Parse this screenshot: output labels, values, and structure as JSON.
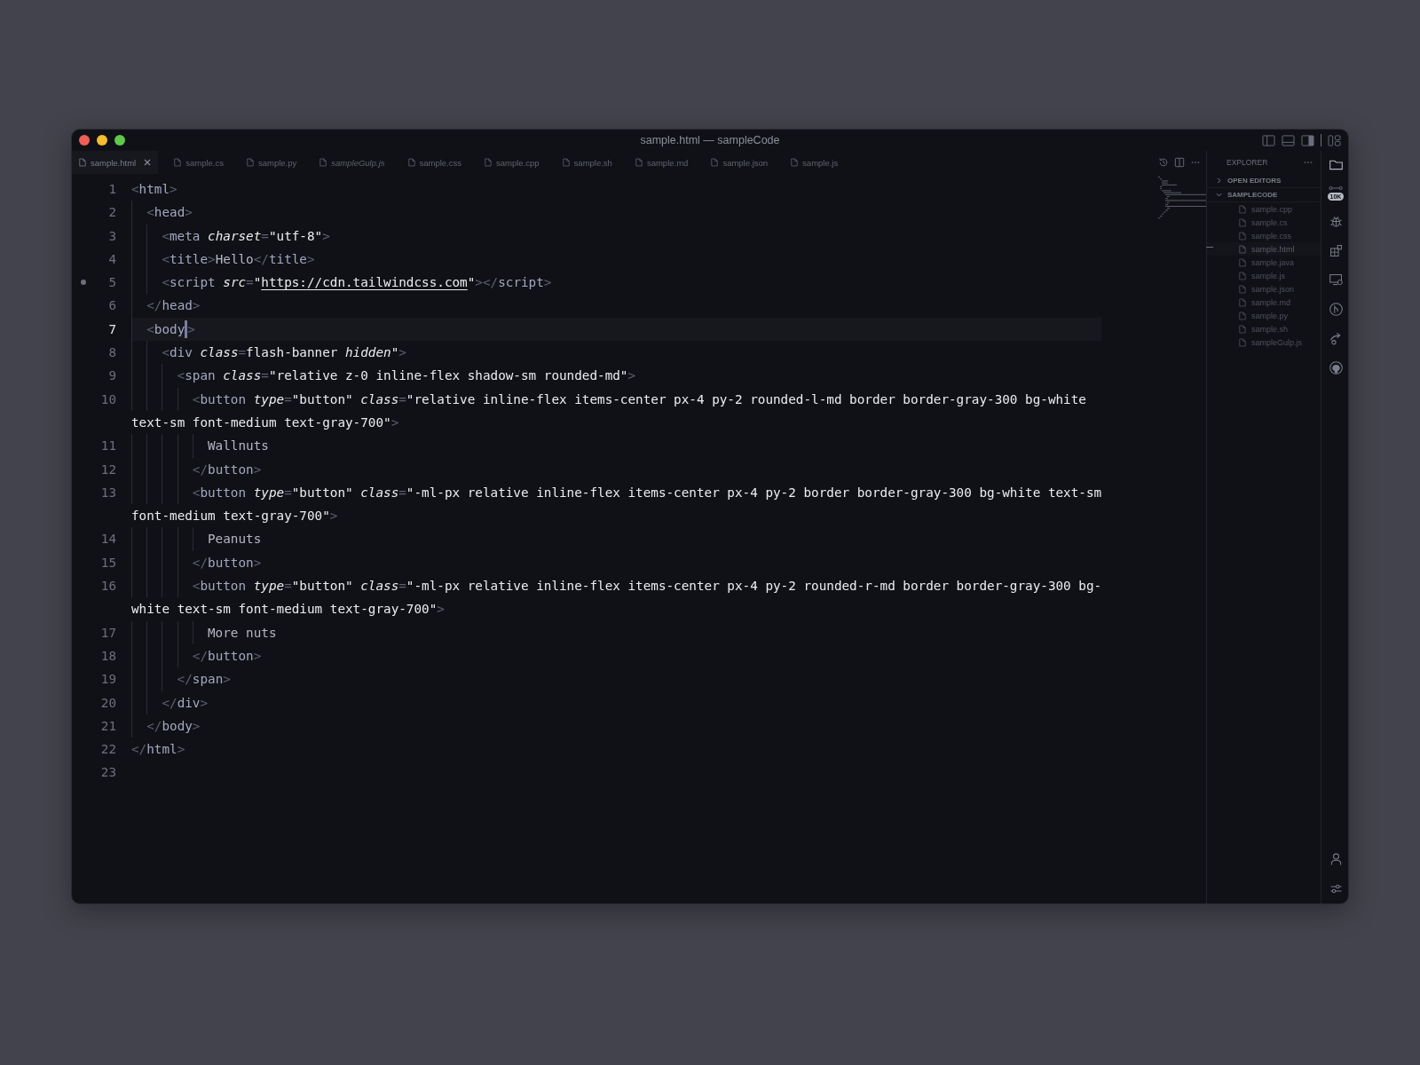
{
  "window": {
    "title": "sample.html — sampleCode"
  },
  "tabs": [
    {
      "label": "sample.html",
      "selected": true,
      "italic": false
    },
    {
      "label": "sample.cs",
      "selected": false,
      "italic": false
    },
    {
      "label": "sample.py",
      "selected": false,
      "italic": false
    },
    {
      "label": "sampleGulp.js",
      "selected": false,
      "italic": true
    },
    {
      "label": "sample.css",
      "selected": false,
      "italic": false
    },
    {
      "label": "sample.cpp",
      "selected": false,
      "italic": false
    },
    {
      "label": "sample.sh",
      "selected": false,
      "italic": false
    },
    {
      "label": "sample.md",
      "selected": false,
      "italic": false
    },
    {
      "label": "sample.json",
      "selected": false,
      "italic": false
    },
    {
      "label": "sample.js",
      "selected": false,
      "italic": false
    }
  ],
  "editor": {
    "lines": [
      {
        "number": "1",
        "current": false,
        "breakpoint": false,
        "tokens": [
          {
            "kind": "punct",
            "text": "<"
          },
          {
            "kind": "tag",
            "text": "html"
          },
          {
            "kind": "punct",
            "text": ">"
          }
        ],
        "children": [
          {
            "number": "2",
            "current": false,
            "breakpoint": false,
            "tokens": [
              {
                "kind": "punct",
                "text": "<"
              },
              {
                "kind": "tag",
                "text": "head"
              },
              {
                "kind": "punct",
                "text": ">"
              }
            ],
            "children": [
              {
                "number": "3",
                "current": false,
                "breakpoint": false,
                "tokens": [
                  {
                    "kind": "punct",
                    "text": "<"
                  },
                  {
                    "kind": "tag",
                    "text": "meta "
                  },
                  {
                    "kind": "attr",
                    "text": "charset"
                  },
                  {
                    "kind": "punct",
                    "text": "="
                  },
                  {
                    "kind": "str",
                    "text": "\"utf-8\""
                  },
                  {
                    "kind": "punct",
                    "text": ">"
                  }
                ]
              },
              {
                "number": "4",
                "current": false,
                "breakpoint": false,
                "tokens": [
                  {
                    "kind": "punct",
                    "text": "<"
                  },
                  {
                    "kind": "tag",
                    "text": "title"
                  },
                  {
                    "kind": "punct",
                    "text": ">"
                  },
                  {
                    "kind": "text",
                    "text": "Hello"
                  },
                  {
                    "kind": "punct",
                    "text": "</"
                  },
                  {
                    "kind": "tag",
                    "text": "title"
                  },
                  {
                    "kind": "punct",
                    "text": ">"
                  }
                ]
              },
              {
                "number": "5",
                "current": false,
                "breakpoint": true,
                "tokens": [
                  {
                    "kind": "punct",
                    "text": "<"
                  },
                  {
                    "kind": "tag",
                    "text": "script "
                  },
                  {
                    "kind": "attr",
                    "text": "src"
                  },
                  {
                    "kind": "punct",
                    "text": "="
                  },
                  {
                    "kind": "str",
                    "text": "\""
                  },
                  {
                    "kind": "link",
                    "text": "https://cdn.tailwindcss.com"
                  },
                  {
                    "kind": "str",
                    "text": "\""
                  },
                  {
                    "kind": "punct",
                    "text": "></"
                  },
                  {
                    "kind": "tag",
                    "text": "script"
                  },
                  {
                    "kind": "punct",
                    "text": ">"
                  }
                ]
              }
            ]
          },
          {
            "number": "6",
            "current": false,
            "breakpoint": false,
            "tokens": [
              {
                "kind": "punct",
                "text": "</"
              },
              {
                "kind": "tag",
                "text": "head"
              },
              {
                "kind": "punct",
                "text": ">"
              }
            ]
          },
          {
            "number": "7",
            "current": true,
            "breakpoint": false,
            "tokens": [
              {
                "kind": "punct",
                "text": "<"
              },
              {
                "kind": "tag",
                "text": "body"
              },
              {
                "kind": "cursor"
              },
              {
                "kind": "punct",
                "text": ">"
              }
            ],
            "children": [
              {
                "number": "8",
                "current": false,
                "breakpoint": false,
                "tokens": [
                  {
                    "kind": "punct",
                    "text": "<"
                  },
                  {
                    "kind": "tag",
                    "text": "div "
                  },
                  {
                    "kind": "attr",
                    "text": "class"
                  },
                  {
                    "kind": "punct",
                    "text": "="
                  },
                  {
                    "kind": "str",
                    "text": "flash-banner "
                  },
                  {
                    "kind": "attr",
                    "text": "hidden"
                  },
                  {
                    "kind": "str",
                    "text": "\""
                  },
                  {
                    "kind": "punct",
                    "text": ">"
                  }
                ],
                "children": [
                  {
                    "number": "9",
                    "current": false,
                    "breakpoint": false,
                    "tokens": [
                      {
                        "kind": "punct",
                        "text": "<"
                      },
                      {
                        "kind": "tag",
                        "text": "span "
                      },
                      {
                        "kind": "attr",
                        "text": "class"
                      },
                      {
                        "kind": "punct",
                        "text": "="
                      },
                      {
                        "kind": "str",
                        "text": "\"relative z-0 inline-flex shadow-sm rounded-md\""
                      },
                      {
                        "kind": "punct",
                        "text": ">"
                      }
                    ],
                    "children": [
                      {
                        "number": "10",
                        "current": false,
                        "breakpoint": false,
                        "tokens": [
                          {
                            "kind": "punct",
                            "text": "<"
                          },
                          {
                            "kind": "tag",
                            "text": "button "
                          },
                          {
                            "kind": "attr",
                            "text": "type"
                          },
                          {
                            "kind": "punct",
                            "text": "="
                          },
                          {
                            "kind": "str",
                            "text": "\"button\" "
                          },
                          {
                            "kind": "attr",
                            "text": "class"
                          },
                          {
                            "kind": "punct",
                            "text": "="
                          },
                          {
                            "kind": "str",
                            "text": "\"relative inline-flex items-center px-4 py-2 rounded-l-md border border-gray-300 bg-white text-sm font-medium text-gray-700\""
                          },
                          {
                            "kind": "punct",
                            "text": ">"
                          }
                        ],
                        "children": [
                          {
                            "number": "11",
                            "current": false,
                            "breakpoint": false,
                            "tokens": [
                              {
                                "kind": "text",
                                "text": "Wallnuts"
                              }
                            ]
                          }
                        ]
                      },
                      {
                        "number": "12",
                        "current": false,
                        "breakpoint": false,
                        "tokens": [
                          {
                            "kind": "punct",
                            "text": "</"
                          },
                          {
                            "kind": "tag",
                            "text": "button"
                          },
                          {
                            "kind": "punct",
                            "text": ">"
                          }
                        ]
                      },
                      {
                        "number": "13",
                        "current": false,
                        "breakpoint": false,
                        "tokens": [
                          {
                            "kind": "punct",
                            "text": "<"
                          },
                          {
                            "kind": "tag",
                            "text": "button "
                          },
                          {
                            "kind": "attr",
                            "text": "type"
                          },
                          {
                            "kind": "punct",
                            "text": "="
                          },
                          {
                            "kind": "str",
                            "text": "\"button\" "
                          },
                          {
                            "kind": "attr",
                            "text": "class"
                          },
                          {
                            "kind": "punct",
                            "text": "="
                          },
                          {
                            "kind": "str",
                            "text": "\"-ml-px relative inline-flex items-center px-4 py-2 border border-gray-300 bg-white text-sm font-medium text-gray-700\""
                          },
                          {
                            "kind": "punct",
                            "text": ">"
                          }
                        ],
                        "children": [
                          {
                            "number": "14",
                            "current": false,
                            "breakpoint": false,
                            "tokens": [
                              {
                                "kind": "text",
                                "text": "Peanuts"
                              }
                            ]
                          }
                        ]
                      },
                      {
                        "number": "15",
                        "current": false,
                        "breakpoint": false,
                        "tokens": [
                          {
                            "kind": "punct",
                            "text": "</"
                          },
                          {
                            "kind": "tag",
                            "text": "button"
                          },
                          {
                            "kind": "punct",
                            "text": ">"
                          }
                        ]
                      },
                      {
                        "number": "16",
                        "current": false,
                        "breakpoint": false,
                        "tokens": [
                          {
                            "kind": "punct",
                            "text": "<"
                          },
                          {
                            "kind": "tag",
                            "text": "button "
                          },
                          {
                            "kind": "attr",
                            "text": "type"
                          },
                          {
                            "kind": "punct",
                            "text": "="
                          },
                          {
                            "kind": "str",
                            "text": "\"button\" "
                          },
                          {
                            "kind": "attr",
                            "text": "class"
                          },
                          {
                            "kind": "punct",
                            "text": "="
                          },
                          {
                            "kind": "str",
                            "text": "\"-ml-px relative inline-flex items-center px-4 py-2 rounded-r-md border border-gray-300 bg-white text-sm font-medium text-gray-700\""
                          },
                          {
                            "kind": "punct",
                            "text": ">"
                          }
                        ],
                        "children": [
                          {
                            "number": "17",
                            "current": false,
                            "breakpoint": false,
                            "tokens": [
                              {
                                "kind": "text",
                                "text": "More nuts"
                              }
                            ]
                          }
                        ]
                      },
                      {
                        "number": "18",
                        "current": false,
                        "breakpoint": false,
                        "tokens": [
                          {
                            "kind": "punct",
                            "text": "</"
                          },
                          {
                            "kind": "tag",
                            "text": "button"
                          },
                          {
                            "kind": "punct",
                            "text": ">"
                          }
                        ]
                      }
                    ]
                  },
                  {
                    "number": "19",
                    "current": false,
                    "breakpoint": false,
                    "tokens": [
                      {
                        "kind": "punct",
                        "text": "</"
                      },
                      {
                        "kind": "tag",
                        "text": "span"
                      },
                      {
                        "kind": "punct",
                        "text": ">"
                      }
                    ]
                  }
                ]
              },
              {
                "number": "20",
                "current": false,
                "breakpoint": false,
                "tokens": [
                  {
                    "kind": "punct",
                    "text": "</"
                  },
                  {
                    "kind": "tag",
                    "text": "div"
                  },
                  {
                    "kind": "punct",
                    "text": ">"
                  }
                ]
              }
            ]
          },
          {
            "number": "21",
            "current": false,
            "breakpoint": false,
            "tokens": [
              {
                "kind": "punct",
                "text": "</"
              },
              {
                "kind": "tag",
                "text": "body"
              },
              {
                "kind": "punct",
                "text": ">"
              }
            ]
          }
        ]
      },
      {
        "number": "22",
        "current": false,
        "breakpoint": false,
        "tokens": [
          {
            "kind": "punct",
            "text": "</"
          },
          {
            "kind": "tag",
            "text": "html"
          },
          {
            "kind": "punct",
            "text": ">"
          }
        ]
      },
      {
        "number": "23",
        "current": false,
        "breakpoint": false
      }
    ]
  },
  "explorer": {
    "title": "EXPLORER",
    "sections": [
      {
        "label": "OPEN EDITORS",
        "expanded": false
      },
      {
        "label": "SAMPLECODE",
        "expanded": true,
        "files": [
          {
            "label": "sample.cpp",
            "selected": false
          },
          {
            "label": "sample.cs",
            "selected": false
          },
          {
            "label": "sample.css",
            "selected": false
          },
          {
            "label": "sample.html",
            "selected": true
          },
          {
            "label": "sample.java",
            "selected": false
          },
          {
            "label": "sample.js",
            "selected": false
          },
          {
            "label": "sample.json",
            "selected": false
          },
          {
            "label": "sample.md",
            "selected": false
          },
          {
            "label": "sample.py",
            "selected": false
          },
          {
            "label": "sample.sh",
            "selected": false
          },
          {
            "label": "sampleGulp.js",
            "selected": false
          }
        ]
      }
    ]
  },
  "activity_bar": {
    "badge": "10K"
  }
}
